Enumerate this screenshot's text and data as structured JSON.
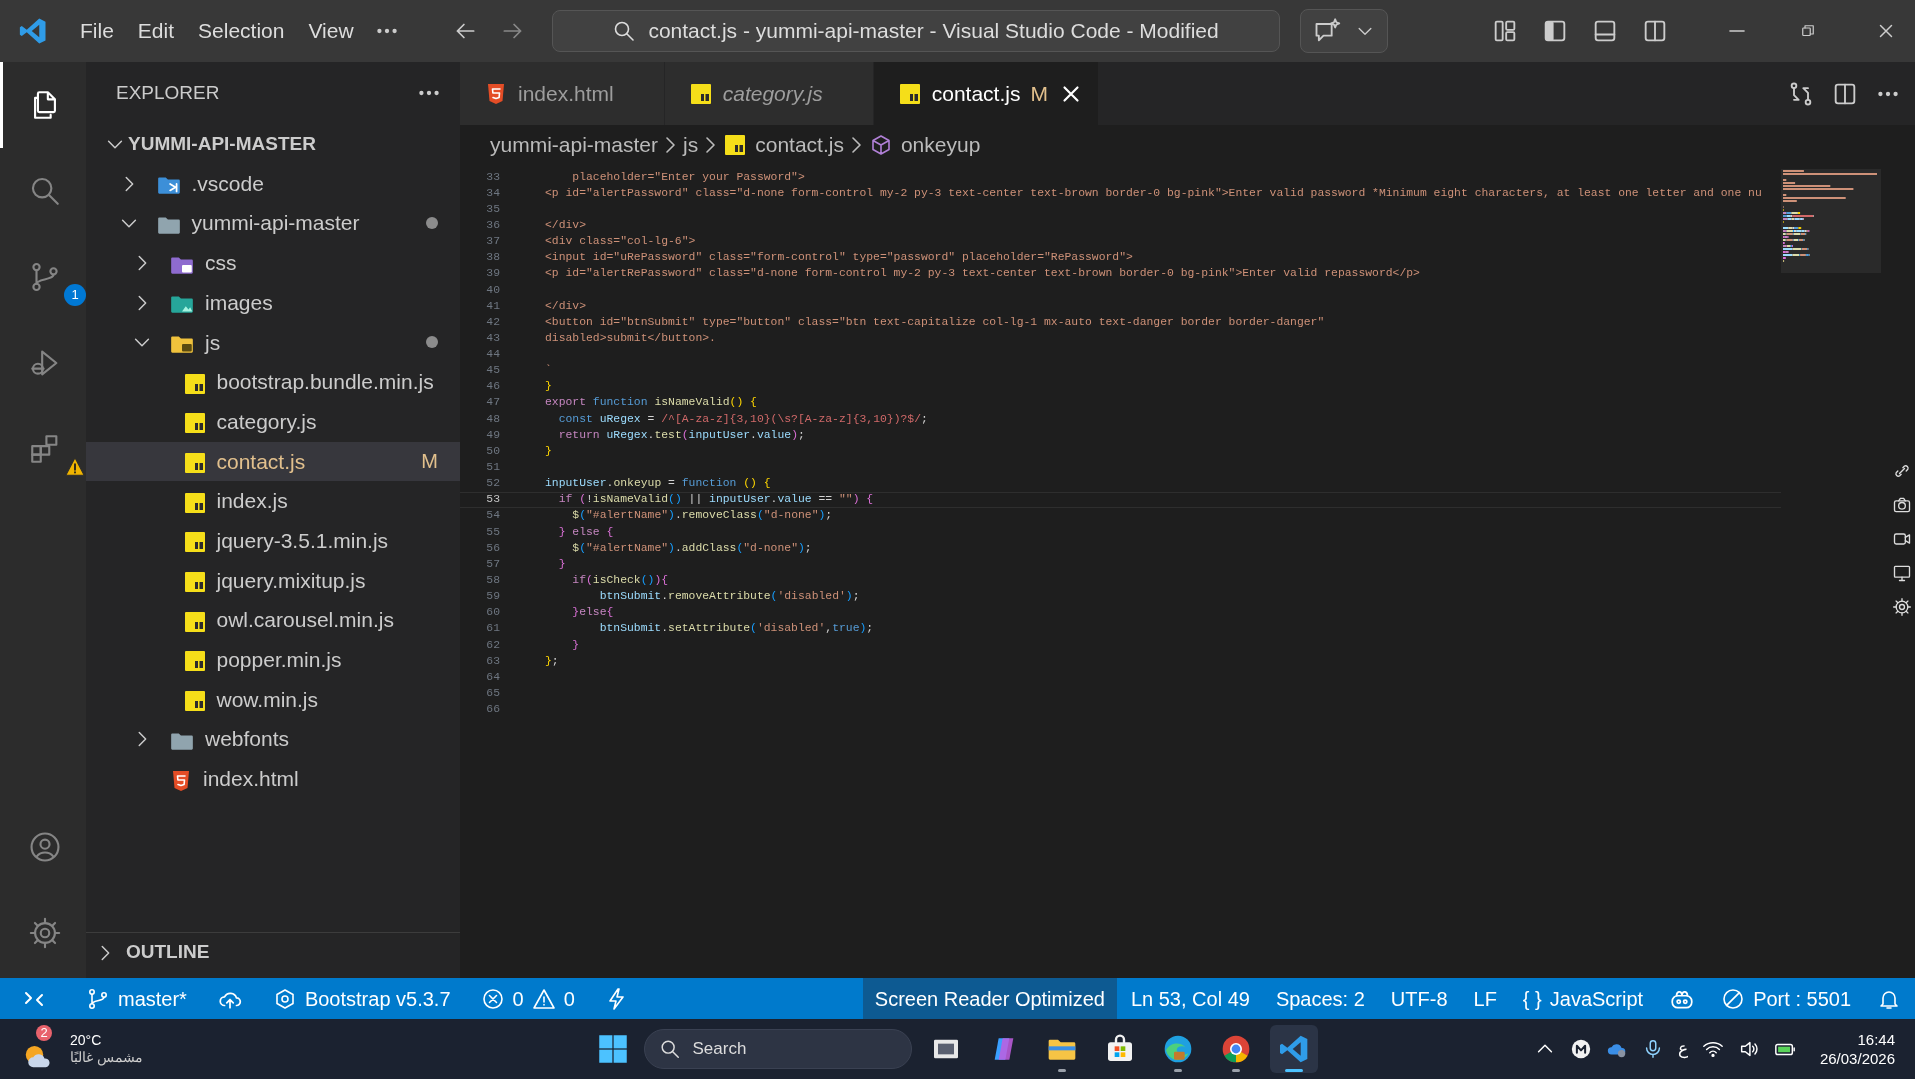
{
  "title_bar": {
    "menu": [
      "File",
      "Edit",
      "Selection",
      "View"
    ],
    "command_center": "contact.js - yummi-api-master - Visual Studio Code - Modified"
  },
  "activity_bar": {
    "top": [
      {
        "kind": "explorer",
        "selected": true
      },
      {
        "kind": "search",
        "selected": false
      },
      {
        "kind": "source-control",
        "selected": false,
        "badge": "1"
      },
      {
        "kind": "run",
        "selected": false
      },
      {
        "kind": "extensions",
        "selected": false,
        "warning": true
      }
    ],
    "bottom": [
      {
        "kind": "account",
        "selected": false
      },
      {
        "kind": "settings",
        "selected": false
      }
    ]
  },
  "sidebar": {
    "title": "EXPLORER",
    "root": {
      "label": "YUMMI-API-MASTER",
      "expanded": true,
      "children": [
        {
          "kind": "vscode",
          "label": ".vscode",
          "expanded": false,
          "selected": false,
          "modified": false
        },
        {
          "kind": "folder",
          "label": "yummi-api-master",
          "expanded": true,
          "selected": false,
          "modified": true,
          "children": [
            {
              "kind": "styles",
              "label": "css",
              "expanded": false,
              "selected": false,
              "modified": false
            },
            {
              "kind": "images",
              "label": "images",
              "expanded": false,
              "selected": false,
              "modified": false
            },
            {
              "kind": "scripts",
              "label": "js",
              "expanded": true,
              "selected": false,
              "modified": true,
              "children": [
                {
                  "kind": "script",
                  "label": "bootstrap.bundle.min.js",
                  "selected": false,
                  "modified": false
                },
                {
                  "kind": "script",
                  "label": "category.js",
                  "selected": false,
                  "modified": false
                },
                {
                  "kind": "script",
                  "label": "contact.js",
                  "selected": true,
                  "modified": true,
                  "status": "M"
                },
                {
                  "kind": "script",
                  "label": "index.js",
                  "selected": false,
                  "modified": false
                },
                {
                  "kind": "script",
                  "label": "jquery-3.5.1.min.js",
                  "selected": false,
                  "modified": false
                },
                {
                  "kind": "script",
                  "label": "jquery.mixitup.js",
                  "selected": false,
                  "modified": false
                },
                {
                  "kind": "script",
                  "label": "owl.carousel.min.js",
                  "selected": false,
                  "modified": false
                },
                {
                  "kind": "script",
                  "label": "popper.min.js",
                  "selected": false,
                  "modified": false
                },
                {
                  "kind": "script",
                  "label": "wow.min.js",
                  "selected": false,
                  "modified": false
                }
              ]
            },
            {
              "kind": "folder",
              "label": "webfonts",
              "expanded": false,
              "selected": false,
              "modified": false
            },
            {
              "kind": "markup",
              "label": "index.html",
              "selected": false,
              "modified": false
            }
          ]
        }
      ]
    },
    "outline": {
      "label": "OUTLINE",
      "expanded": false
    }
  },
  "tabs": [
    {
      "label": "index.html",
      "kind": "markup",
      "selected": false,
      "preview": false,
      "modified": false
    },
    {
      "label": "category.js",
      "kind": "script",
      "selected": false,
      "preview": true,
      "modified": false
    },
    {
      "label": "contact.js",
      "kind": "script",
      "selected": true,
      "preview": false,
      "modified": true,
      "status": "M"
    }
  ],
  "breadcrumb": [
    {
      "kind": "plain",
      "label": "yummi-api-master"
    },
    {
      "kind": "plain",
      "label": "js"
    },
    {
      "kind": "script",
      "label": "contact.js"
    },
    {
      "kind": "method",
      "label": "onkeyup"
    }
  ],
  "editor": {
    "lines": [
      {
        "number": "33",
        "current": false,
        "tokens": [
          {
            "kind": "string",
            "text": "    placeholder=\"Enter your Password\">"
          }
        ]
      },
      {
        "number": "34",
        "current": false,
        "tokens": [
          {
            "kind": "string",
            "text": "<p id=\"alertPassword\" class=\"d-none form-control my-2 py-3 text-center text-brown border-0 bg-pink\">Enter valid password *Minimum eight characters, at least one letter and one nu"
          }
        ]
      },
      {
        "number": "35",
        "current": false
      },
      {
        "number": "36",
        "current": false,
        "tokens": [
          {
            "kind": "string",
            "text": "</div>"
          }
        ]
      },
      {
        "number": "37",
        "current": false,
        "tokens": [
          {
            "kind": "string",
            "text": "<div class=\"col-lg-6\">"
          }
        ]
      },
      {
        "number": "38",
        "current": false,
        "tokens": [
          {
            "kind": "string",
            "text": "<input id=\"uRePassword\" class=\"form-control\" type=\"password\" placeholder=\"RePassword\">"
          }
        ]
      },
      {
        "number": "39",
        "current": false,
        "tokens": [
          {
            "kind": "string",
            "text": "<p id=\"alertRePassword\" class=\"d-none form-control my-2 py-3 text-center text-brown border-0 bg-pink\">Enter valid repassword</p>"
          }
        ]
      },
      {
        "number": "40",
        "current": false
      },
      {
        "number": "41",
        "current": false,
        "tokens": [
          {
            "kind": "string",
            "text": "</div>"
          }
        ]
      },
      {
        "number": "42",
        "current": false,
        "tokens": [
          {
            "kind": "string",
            "text": "<button id=\"btnSubmit\" type=\"button\" class=\"btn text-capitalize col-lg-1 mx-auto text-danger border border-danger\""
          }
        ]
      },
      {
        "number": "43",
        "current": false,
        "tokens": [
          {
            "kind": "string",
            "text": "disabled>submit</button>."
          }
        ]
      },
      {
        "number": "44",
        "current": false
      },
      {
        "number": "45",
        "current": false,
        "tokens": [
          {
            "kind": "string",
            "text": "`"
          }
        ]
      },
      {
        "number": "46",
        "current": false,
        "tokens": [
          {
            "kind": "bracket1",
            "text": "}"
          }
        ]
      },
      {
        "number": "47",
        "current": false,
        "tokens": [
          {
            "kind": "control",
            "text": "export"
          },
          {
            "kind": "keyword",
            "text": " function"
          },
          {
            "kind": "func",
            "text": " isNameValid"
          },
          {
            "kind": "bracket1",
            "text": "()"
          },
          {
            "kind": "bracket1",
            "text": " {"
          }
        ]
      },
      {
        "number": "48",
        "current": false,
        "tokens": [
          {
            "kind": "keyword",
            "text": "  const"
          },
          {
            "kind": "var",
            "text": " uRegex"
          },
          {
            "kind": "plain",
            "text": " = "
          },
          {
            "kind": "regex",
            "text": "/^[A-za-z]{3,10}(\\s?[A-za-z]{3,10})?$/"
          },
          {
            "kind": "plain",
            "text": ";"
          }
        ]
      },
      {
        "number": "49",
        "current": false,
        "tokens": [
          {
            "kind": "control",
            "text": "  return"
          },
          {
            "kind": "var",
            "text": " uRegex"
          },
          {
            "kind": "plain",
            "text": "."
          },
          {
            "kind": "func",
            "text": "test"
          },
          {
            "kind": "bracket2",
            "text": "("
          },
          {
            "kind": "var",
            "text": "inputUser"
          },
          {
            "kind": "plain",
            "text": "."
          },
          {
            "kind": "var",
            "text": "value"
          },
          {
            "kind": "bracket2",
            "text": ")"
          },
          {
            "kind": "plain",
            "text": ";"
          }
        ]
      },
      {
        "number": "50",
        "current": false,
        "tokens": [
          {
            "kind": "bracket1",
            "text": "}"
          }
        ]
      },
      {
        "number": "51",
        "current": false
      },
      {
        "number": "52",
        "current": false,
        "tokens": [
          {
            "kind": "var",
            "text": "inputUser"
          },
          {
            "kind": "plain",
            "text": "."
          },
          {
            "kind": "func",
            "text": "onkeyup"
          },
          {
            "kind": "plain",
            "text": " = "
          },
          {
            "kind": "keyword",
            "text": "function"
          },
          {
            "kind": "bracket1",
            "text": " ()"
          },
          {
            "kind": "bracket1",
            "text": " {"
          }
        ]
      },
      {
        "number": "53",
        "current": true,
        "tokens": [
          {
            "kind": "control",
            "text": "  if"
          },
          {
            "kind": "bracket2",
            "text": " ("
          },
          {
            "kind": "plain",
            "text": "!"
          },
          {
            "kind": "func",
            "text": "isNameValid"
          },
          {
            "kind": "bracket3",
            "text": "()"
          },
          {
            "kind": "plain",
            "text": " || "
          },
          {
            "kind": "var",
            "text": "inputUser"
          },
          {
            "kind": "plain",
            "text": "."
          },
          {
            "kind": "var",
            "text": "value"
          },
          {
            "kind": "plain",
            "text": " == "
          },
          {
            "kind": "string",
            "text": "\"\""
          },
          {
            "kind": "bracket2",
            "text": ")"
          },
          {
            "kind": "bracket2",
            "text": " {"
          }
        ]
      },
      {
        "number": "54",
        "current": false,
        "tokens": [
          {
            "kind": "func",
            "text": "    $"
          },
          {
            "kind": "bracket3",
            "text": "("
          },
          {
            "kind": "string",
            "text": "\"#alertName\""
          },
          {
            "kind": "bracket3",
            "text": ")"
          },
          {
            "kind": "plain",
            "text": "."
          },
          {
            "kind": "func",
            "text": "removeClass"
          },
          {
            "kind": "bracket3",
            "text": "("
          },
          {
            "kind": "string",
            "text": "\"d-none\""
          },
          {
            "kind": "bracket3",
            "text": ")"
          },
          {
            "kind": "plain",
            "text": ";"
          }
        ]
      },
      {
        "number": "55",
        "current": false,
        "tokens": [
          {
            "kind": "bracket2",
            "text": "  }"
          },
          {
            "kind": "control",
            "text": " else"
          },
          {
            "kind": "bracket2",
            "text": " {"
          }
        ]
      },
      {
        "number": "56",
        "current": false,
        "tokens": [
          {
            "kind": "func",
            "text": "    $"
          },
          {
            "kind": "bracket3",
            "text": "("
          },
          {
            "kind": "string",
            "text": "\"#alertName\""
          },
          {
            "kind": "bracket3",
            "text": ")"
          },
          {
            "kind": "plain",
            "text": "."
          },
          {
            "kind": "func",
            "text": "addClass"
          },
          {
            "kind": "bracket3",
            "text": "("
          },
          {
            "kind": "string",
            "text": "\"d-none\""
          },
          {
            "kind": "bracket3",
            "text": ")"
          },
          {
            "kind": "plain",
            "text": ";"
          }
        ]
      },
      {
        "number": "57",
        "current": false,
        "tokens": [
          {
            "kind": "bracket2",
            "text": "  }"
          }
        ]
      },
      {
        "number": "58",
        "current": false,
        "tokens": [
          {
            "kind": "control",
            "text": "    if"
          },
          {
            "kind": "bracket2",
            "text": "("
          },
          {
            "kind": "func",
            "text": "isCheck"
          },
          {
            "kind": "bracket3",
            "text": "()"
          },
          {
            "kind": "bracket2",
            "text": "){"
          }
        ]
      },
      {
        "number": "59",
        "current": false,
        "tokens": [
          {
            "kind": "var",
            "text": "        btnSubmit"
          },
          {
            "kind": "plain",
            "text": "."
          },
          {
            "kind": "func",
            "text": "removeAttribute"
          },
          {
            "kind": "bracket3",
            "text": "("
          },
          {
            "kind": "string",
            "text": "'disabled'"
          },
          {
            "kind": "bracket3",
            "text": ")"
          },
          {
            "kind": "plain",
            "text": ";"
          }
        ]
      },
      {
        "number": "60",
        "current": false,
        "tokens": [
          {
            "kind": "bracket2",
            "text": "    }"
          },
          {
            "kind": "control",
            "text": "else"
          },
          {
            "kind": "bracket2",
            "text": "{"
          }
        ]
      },
      {
        "number": "61",
        "current": false,
        "tokens": [
          {
            "kind": "var",
            "text": "        btnSubmit"
          },
          {
            "kind": "plain",
            "text": "."
          },
          {
            "kind": "func",
            "text": "setAttribute"
          },
          {
            "kind": "bracket3",
            "text": "("
          },
          {
            "kind": "string",
            "text": "'disabled'"
          },
          {
            "kind": "plain",
            "text": ","
          },
          {
            "kind": "keyword",
            "text": "true"
          },
          {
            "kind": "bracket3",
            "text": ")"
          },
          {
            "kind": "plain",
            "text": ";"
          }
        ]
      },
      {
        "number": "62",
        "current": false,
        "tokens": [
          {
            "kind": "bracket2",
            "text": "    }"
          }
        ]
      },
      {
        "number": "63",
        "current": false,
        "tokens": [
          {
            "kind": "bracket1",
            "text": "}"
          },
          {
            "kind": "plain",
            "text": ";"
          }
        ]
      },
      {
        "number": "64",
        "current": false
      },
      {
        "number": "65",
        "current": false
      },
      {
        "number": "66",
        "current": false
      }
    ]
  },
  "status_bar": {
    "left": [
      {
        "kind": "remote"
      },
      {
        "kind": "branch",
        "text": "master*"
      },
      {
        "kind": "sync"
      },
      {
        "kind": "extension",
        "text": "Bootstrap v5.3.7"
      },
      {
        "kind": "problems",
        "errors": "0",
        "warnings": "0"
      },
      {
        "kind": "bolt"
      }
    ],
    "right": [
      {
        "kind": "text",
        "text": "Screen Reader Optimized",
        "highlighted": true
      },
      {
        "kind": "text",
        "text": "Ln 53, Col 49",
        "highlighted": false
      },
      {
        "kind": "text",
        "text": "Spaces: 2",
        "highlighted": false
      },
      {
        "kind": "text",
        "text": "UTF-8",
        "highlighted": false
      },
      {
        "kind": "text",
        "text": "LF",
        "highlighted": false
      },
      {
        "kind": "language",
        "glyph": "{ }",
        "text": "JavaScript",
        "highlighted": false
      },
      {
        "kind": "copilot",
        "highlighted": false
      },
      {
        "kind": "port",
        "text": "Port : 5501",
        "highlighted": false
      },
      {
        "kind": "bell",
        "highlighted": false
      }
    ]
  },
  "taskbar": {
    "weather": {
      "badge": "2",
      "temperature": "20°C",
      "condition": "مشمس غالبًا"
    },
    "search": {
      "placeholder": "Search"
    },
    "apps": [
      {
        "kind": "task-view",
        "selected": false,
        "running": false
      },
      {
        "kind": "assistant",
        "selected": false,
        "running": false
      },
      {
        "kind": "folder",
        "selected": false,
        "running": true
      },
      {
        "kind": "store",
        "selected": false,
        "running": false
      },
      {
        "kind": "browser-wave",
        "selected": false,
        "running": true
      },
      {
        "kind": "browser-ring",
        "selected": false,
        "running": true
      },
      {
        "kind": "editor",
        "selected": true,
        "running": true
      }
    ],
    "tray": [
      {
        "kind": "chevron"
      },
      {
        "kind": "round"
      },
      {
        "kind": "cloud"
      },
      {
        "kind": "mic"
      },
      {
        "kind": "language",
        "text": "ع"
      },
      {
        "kind": "wifi"
      },
      {
        "kind": "volume"
      },
      {
        "kind": "battery"
      }
    ],
    "time": "16:44",
    "date": "26/03/2026"
  }
}
